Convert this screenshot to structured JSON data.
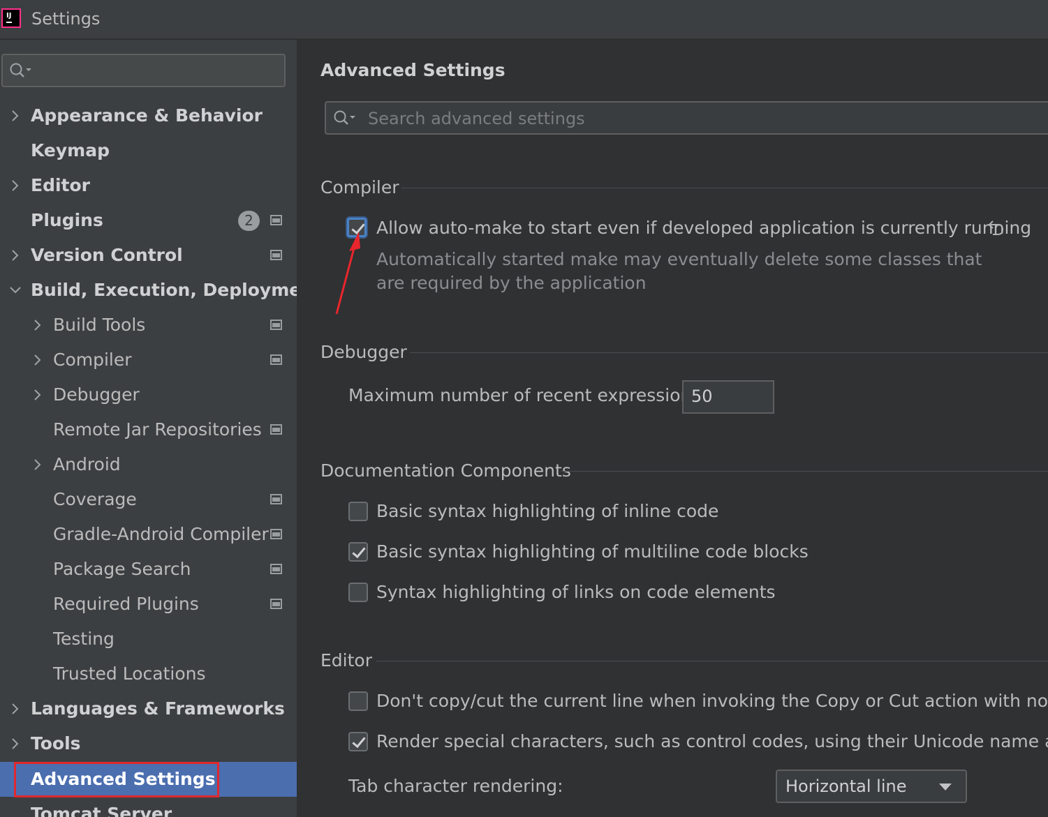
{
  "window": {
    "title": "Settings"
  },
  "sidebar": {
    "search_placeholder": "",
    "items": [
      {
        "label": "Appearance & Behavior"
      },
      {
        "label": "Keymap"
      },
      {
        "label": "Editor"
      },
      {
        "label": "Plugins",
        "badge": "2"
      },
      {
        "label": "Version Control"
      },
      {
        "label": "Build, Execution, Deployment"
      },
      {
        "label": "Build Tools"
      },
      {
        "label": "Compiler"
      },
      {
        "label": "Debugger"
      },
      {
        "label": "Remote Jar Repositories"
      },
      {
        "label": "Android"
      },
      {
        "label": "Coverage"
      },
      {
        "label": "Gradle-Android Compiler"
      },
      {
        "label": "Package Search"
      },
      {
        "label": "Required Plugins"
      },
      {
        "label": "Testing"
      },
      {
        "label": "Trusted Locations"
      },
      {
        "label": "Languages & Frameworks"
      },
      {
        "label": "Tools"
      },
      {
        "label": "Advanced Settings"
      },
      {
        "label": "Tomcat Server"
      }
    ]
  },
  "main": {
    "title": "Advanced Settings",
    "search_placeholder": "Search advanced settings",
    "compiler": {
      "heading": "Compiler",
      "auto_make": {
        "label": "Allow auto-make to start even if developed application is currently running",
        "checked": true,
        "hint_line1": "Automatically started make may eventually delete some classes that",
        "hint_line2": "are required by the application"
      }
    },
    "debugger": {
      "heading": "Debugger",
      "max_expressions_label": "Maximum number of recent expressions:",
      "max_expressions_value": "50"
    },
    "documentation": {
      "heading": "Documentation Components",
      "options": [
        {
          "label": "Basic syntax highlighting of inline code",
          "checked": false
        },
        {
          "label": "Basic syntax highlighting of multiline code blocks",
          "checked": true
        },
        {
          "label": "Syntax highlighting of links on code elements",
          "checked": false
        }
      ]
    },
    "editor": {
      "heading": "Editor",
      "options": [
        {
          "label": "Don't copy/cut the current line when invoking the Copy or Cut action with no select",
          "checked": false
        },
        {
          "label": "Render special characters, such as control codes, using their Unicode name abbrevia",
          "checked": true
        }
      ],
      "tab_rendering_label": "Tab character rendering:",
      "tab_rendering_value": "Horizontal line"
    }
  },
  "colors": {
    "selection": "#4b6eaf",
    "annotation_red": "#e0282e",
    "focus_blue": "#4a82c8"
  }
}
